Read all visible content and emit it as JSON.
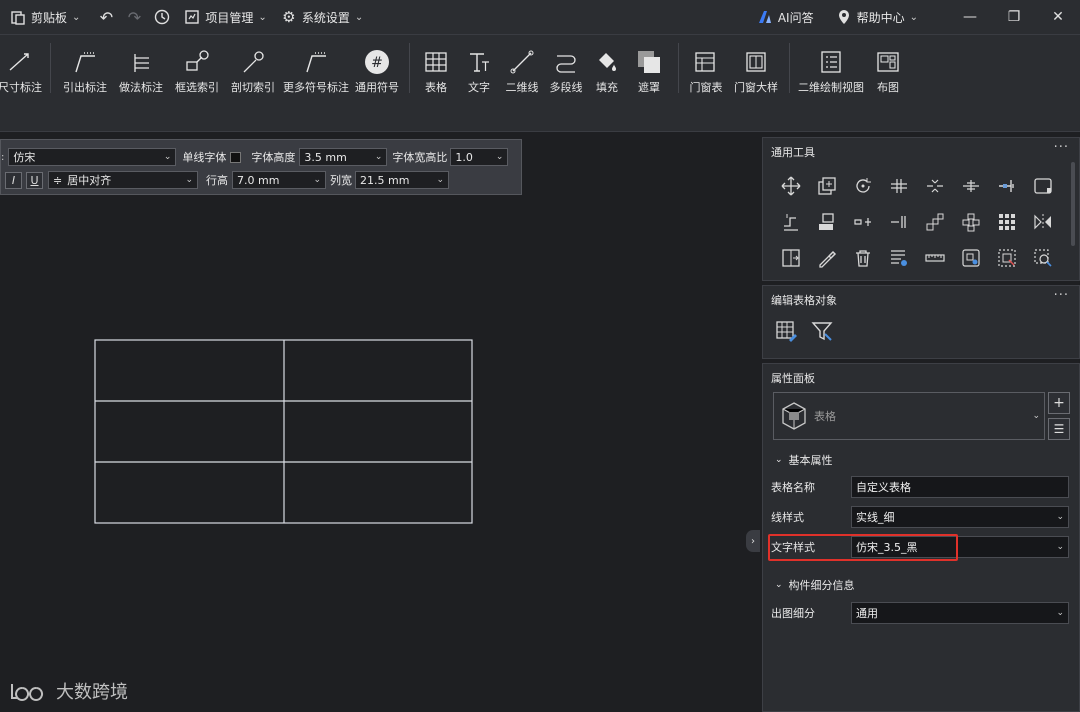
{
  "topbar": {
    "clipboard": "剪贴板",
    "project_mgmt": "项目管理",
    "system_settings": "系统设置",
    "ai": "AI问答",
    "help": "帮助中心"
  },
  "ribbon": {
    "buttons": [
      "尺寸标注",
      "引出标注",
      "做法标注",
      "框选索引",
      "剖切索引",
      "更多符号标注",
      "通用符号",
      "表格",
      "文字",
      "二维线",
      "多段线",
      "填充",
      "遮罩",
      "门窗表",
      "门窗大样",
      "二维绘制视图",
      "布图"
    ]
  },
  "format_bar": {
    "font": "仿宋",
    "single_line_font_label": "单线字体",
    "font_height_label": "字体高度",
    "font_height": "3.5 mm",
    "width_ratio_label": "字体宽高比",
    "width_ratio": "1.0",
    "italic": "I",
    "underline": "U",
    "align": "居中对齐",
    "row_height_label": "行高",
    "row_height": "7.0 mm",
    "col_width_label": "列宽",
    "col_width": "21.5 mm"
  },
  "panels": {
    "common_tools": "通用工具",
    "edit_table": "编辑表格对象",
    "properties": "属性面板",
    "more": "···"
  },
  "properties": {
    "type": "表格",
    "basic_section": "基本属性",
    "rows": [
      {
        "label": "表格名称",
        "value": "自定义表格",
        "dropdown": false
      },
      {
        "label": "线样式",
        "value": "实线_细",
        "dropdown": true
      },
      {
        "label": "文字样式",
        "value": "仿宋_3.5_黑",
        "dropdown": true
      }
    ],
    "component_section": "构件细分信息",
    "output_label": "出图细分",
    "output_value": "通用"
  },
  "watermark": "大数跨境"
}
